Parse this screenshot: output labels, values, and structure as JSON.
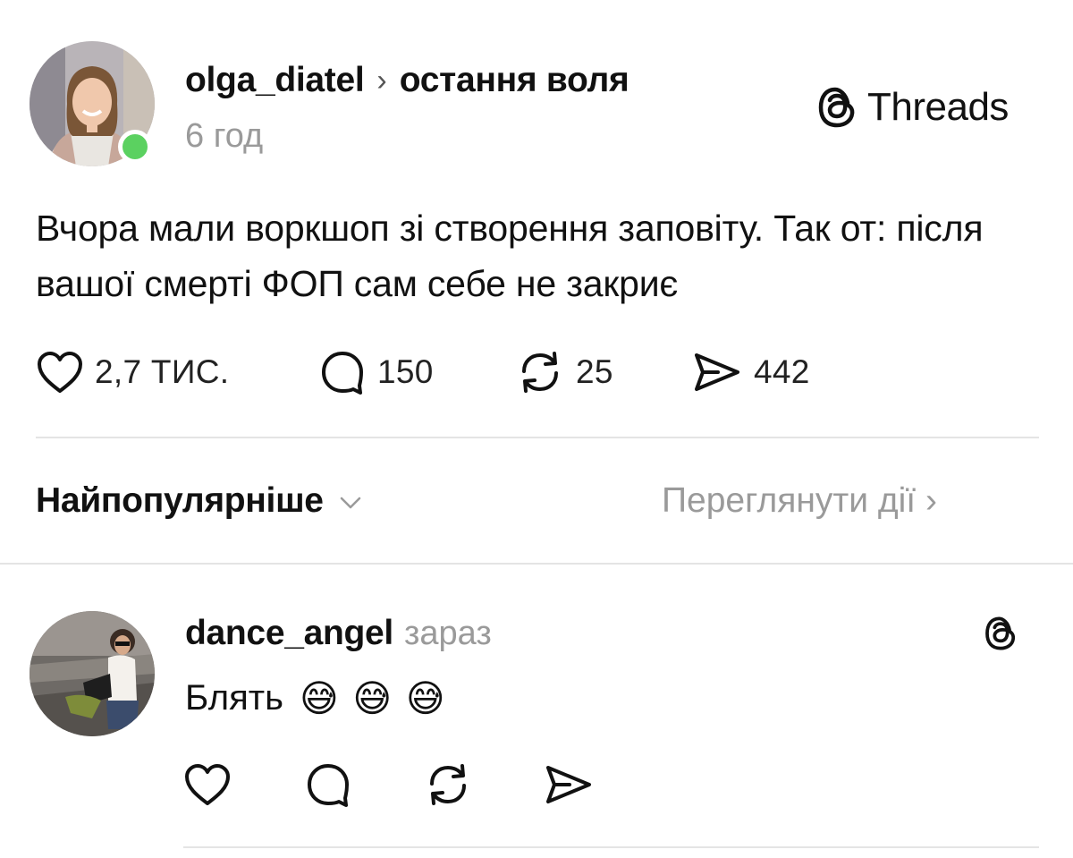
{
  "post": {
    "author": "olga_diatel",
    "separator": "›",
    "community": "остання воля",
    "time": "6 год",
    "text": "Вчора мали воркшоп зі створення заповіту. Так от: після вашої смерті ФОП сам себе не закриє",
    "stats": {
      "likes": "2,7 ТИС.",
      "replies": "150",
      "reposts": "25",
      "shares": "442"
    },
    "icons": {
      "like": "heart-icon",
      "reply": "comment-bubble-icon",
      "repost": "repost-arrows-icon",
      "share": "send-icon"
    }
  },
  "branding": {
    "threads_label": "Threads",
    "threads_icon": "threads-logo-icon"
  },
  "replies_bar": {
    "sort_label": "Найпопулярніше",
    "sort_icon": "chevron-down-icon",
    "view_activity": "Переглянути дії ›"
  },
  "reply": {
    "author": "dance_angel",
    "time": "зараз",
    "text": "Блять",
    "emoji": "😅 😅 😅",
    "icons": [
      "heart-icon",
      "comment-bubble-icon",
      "repost-arrows-icon",
      "send-icon"
    ]
  },
  "colors": {
    "online": "#5bd160",
    "muted": "#9a9a9a",
    "text": "#111111",
    "divider": "#e4e4e4"
  }
}
